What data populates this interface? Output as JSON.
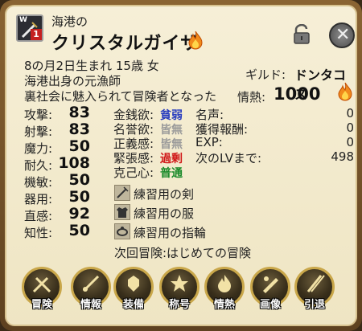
{
  "header": {
    "weapon_letter": "W",
    "weapon_level": "1",
    "subtitle": "海港の",
    "name": "クリスタルガイザ"
  },
  "profile": {
    "birth": "8の月2日生まれ 15歳 女",
    "origin": "海港出身の元漁師",
    "bio": "裏社会に魅入られて冒険者となった",
    "guild_label": "ギルド:",
    "guild_value": "ドンタコス",
    "passion_label": "情熱:",
    "passion_value": "1000"
  },
  "stats": [
    {
      "label": "攻撃:",
      "value": "83"
    },
    {
      "label": "射撃:",
      "value": "83"
    },
    {
      "label": "魔力:",
      "value": "50"
    },
    {
      "label": "耐久:",
      "value": "108"
    },
    {
      "label": "機敏:",
      "value": "50"
    },
    {
      "label": "器用:",
      "value": "50"
    },
    {
      "label": "直感:",
      "value": "92"
    },
    {
      "label": "知性:",
      "value": "50"
    }
  ],
  "desires": [
    {
      "label": "金銭欲:",
      "value": "貧弱",
      "color": "#2b3fbf"
    },
    {
      "label": "名誉欲:",
      "value": "皆無",
      "color": "#9a9a9a"
    },
    {
      "label": "正義感:",
      "value": "皆無",
      "color": "#9a9a9a"
    },
    {
      "label": "緊張感:",
      "value": "過剰",
      "color": "#d01818"
    },
    {
      "label": "克己心:",
      "value": "普通",
      "color": "#1a8a2a"
    }
  ],
  "records": [
    {
      "label": "名声:",
      "value": "0"
    },
    {
      "label": "獲得報酬:",
      "value": "0"
    },
    {
      "label": "EXP:",
      "value": "0"
    },
    {
      "label": "次のLVまで:",
      "value": "498"
    }
  ],
  "equipment": [
    {
      "name": "練習用の剣",
      "icon": "sword-icon"
    },
    {
      "name": "練習用の服",
      "icon": "clothes-icon"
    },
    {
      "name": "練習用の指輪",
      "icon": "ring-icon"
    }
  ],
  "next_adventure": "次回冒険:はじめての冒険",
  "buttons": [
    {
      "label": "冒険",
      "icon": "adventure-icon"
    },
    {
      "label": "情報",
      "icon": "info-icon"
    },
    {
      "label": "装備",
      "icon": "equipment-icon"
    },
    {
      "label": "称号",
      "icon": "title-icon"
    },
    {
      "label": "情熱",
      "icon": "passion-icon"
    },
    {
      "label": "画像",
      "icon": "image-icon"
    },
    {
      "label": "引退",
      "icon": "retire-icon"
    }
  ],
  "colors": {
    "panel": "#f3ebce",
    "frame": "#6f4f28",
    "flame": "#f08a1c",
    "button_rim": "#c9a74a"
  }
}
